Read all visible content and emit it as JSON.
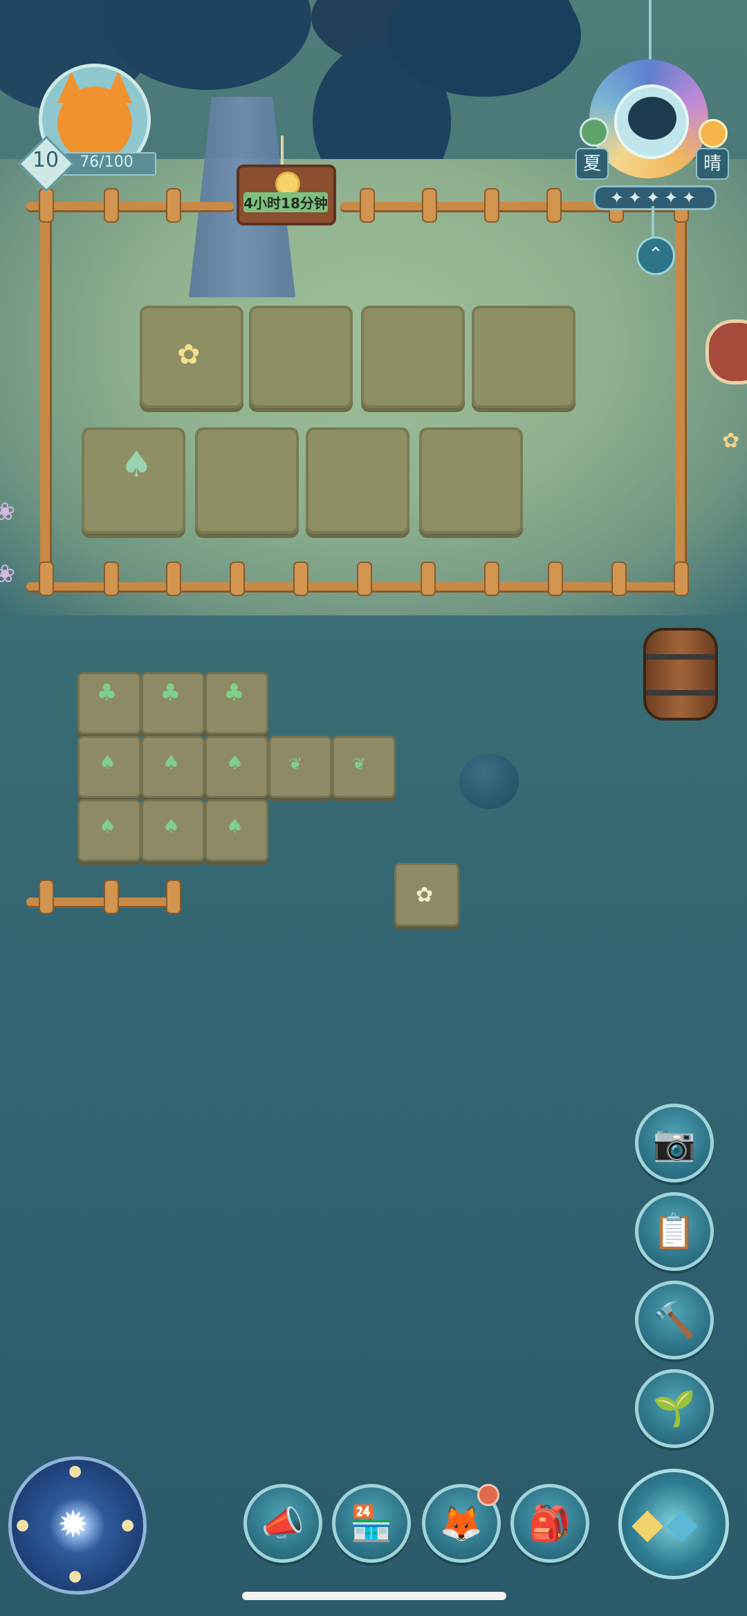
{
  "player": {
    "level": "10",
    "xp": "76/100",
    "avatar_icon": "fox-avatar-icon"
  },
  "timer_sign": {
    "text": "4小时18分钟"
  },
  "weather": {
    "season": "夏",
    "condition": "晴",
    "rating_stars": 5,
    "accent_colors": [
      "#5d7fd0",
      "#c58ad6",
      "#f0b75c"
    ]
  },
  "side_buttons": [
    {
      "name": "camera-button",
      "icon": "camera-icon"
    },
    {
      "name": "tasks-button",
      "icon": "clipboard-icon"
    },
    {
      "name": "build-button",
      "icon": "hammer-icon"
    },
    {
      "name": "plant-button",
      "icon": "sprout-icon"
    }
  ],
  "bottom_buttons": [
    {
      "name": "announcement-button",
      "icon": "megaphone-icon"
    },
    {
      "name": "shop-button",
      "icon": "shop-icon"
    },
    {
      "name": "character-button",
      "icon": "fox-icon",
      "has_notification": true
    },
    {
      "name": "backpack-button",
      "icon": "backpack-icon"
    }
  ],
  "colors": {
    "water": "#346772",
    "meadow": "#8fb08e",
    "fence": "#c98a45",
    "button_ring": "#9fd3d9"
  }
}
